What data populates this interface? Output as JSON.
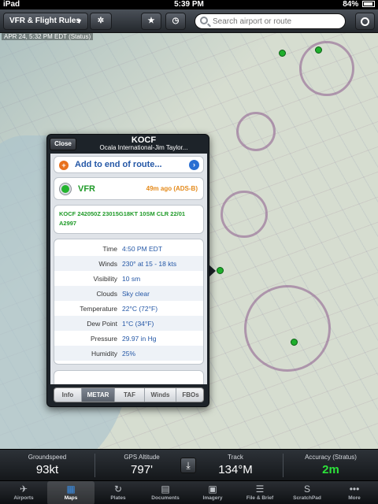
{
  "status_bar": {
    "carrier": "iPad",
    "time": "5:39 PM",
    "battery": "84%"
  },
  "toolbar": {
    "layer_label": "VFR & Flight Rules",
    "search_placeholder": "Search airport or route"
  },
  "map": {
    "timestamp": "APR 24, 5:32 PM EDT (Status)"
  },
  "popover": {
    "close_label": "Close",
    "ident": "KOCF",
    "name": "Ocala International-Jim Taylor...",
    "add_route_label": "Add to end of route...",
    "flight_category": "VFR",
    "age": "49m ago (ADS-B)",
    "raw_metar": "KOCF 242050Z 23015G18KT 10SM CLR 22/01 A2997",
    "rows": [
      {
        "key": "Time",
        "value": "4:50 PM EDT"
      },
      {
        "key": "Winds",
        "value": "230° at 15 - 18 kts"
      },
      {
        "key": "Visibility",
        "value": "10 sm"
      },
      {
        "key": "Clouds",
        "value": "Sky clear"
      },
      {
        "key": "Temperature",
        "value": "22°C (72°F)"
      },
      {
        "key": "Dew Point",
        "value": "1°C (34°F)"
      },
      {
        "key": "Pressure",
        "value": "29.97 in Hg"
      },
      {
        "key": "Humidity",
        "value": "25%"
      }
    ],
    "tabs": [
      "Info",
      "METAR",
      "TAF",
      "Winds",
      "FBOs"
    ],
    "active_tab": "METAR"
  },
  "info_bar": {
    "groundspeed_label": "Groundspeed",
    "groundspeed": "93kt",
    "altitude_label": "GPS Altitude",
    "altitude": "797'",
    "track_label": "Track",
    "track": "134°M",
    "accuracy_label": "Accuracy (Stratus)",
    "accuracy": "2m"
  },
  "tab_bar": {
    "items": [
      {
        "label": "Airports",
        "icon": "airports-icon"
      },
      {
        "label": "Maps",
        "icon": "maps-icon"
      },
      {
        "label": "Plates",
        "icon": "plates-icon"
      },
      {
        "label": "Documents",
        "icon": "documents-icon"
      },
      {
        "label": "Imagery",
        "icon": "imagery-icon"
      },
      {
        "label": "File & Brief",
        "icon": "file-brief-icon"
      },
      {
        "label": "ScratchPad",
        "icon": "scratchpad-icon"
      },
      {
        "label": "More",
        "icon": "more-icon"
      }
    ],
    "active": "Maps"
  },
  "colors": {
    "accent": "#2457a6",
    "vfr_green": "#1f9a28",
    "age_orange": "#e48a1b",
    "accuracy_green": "#2ce23a"
  }
}
